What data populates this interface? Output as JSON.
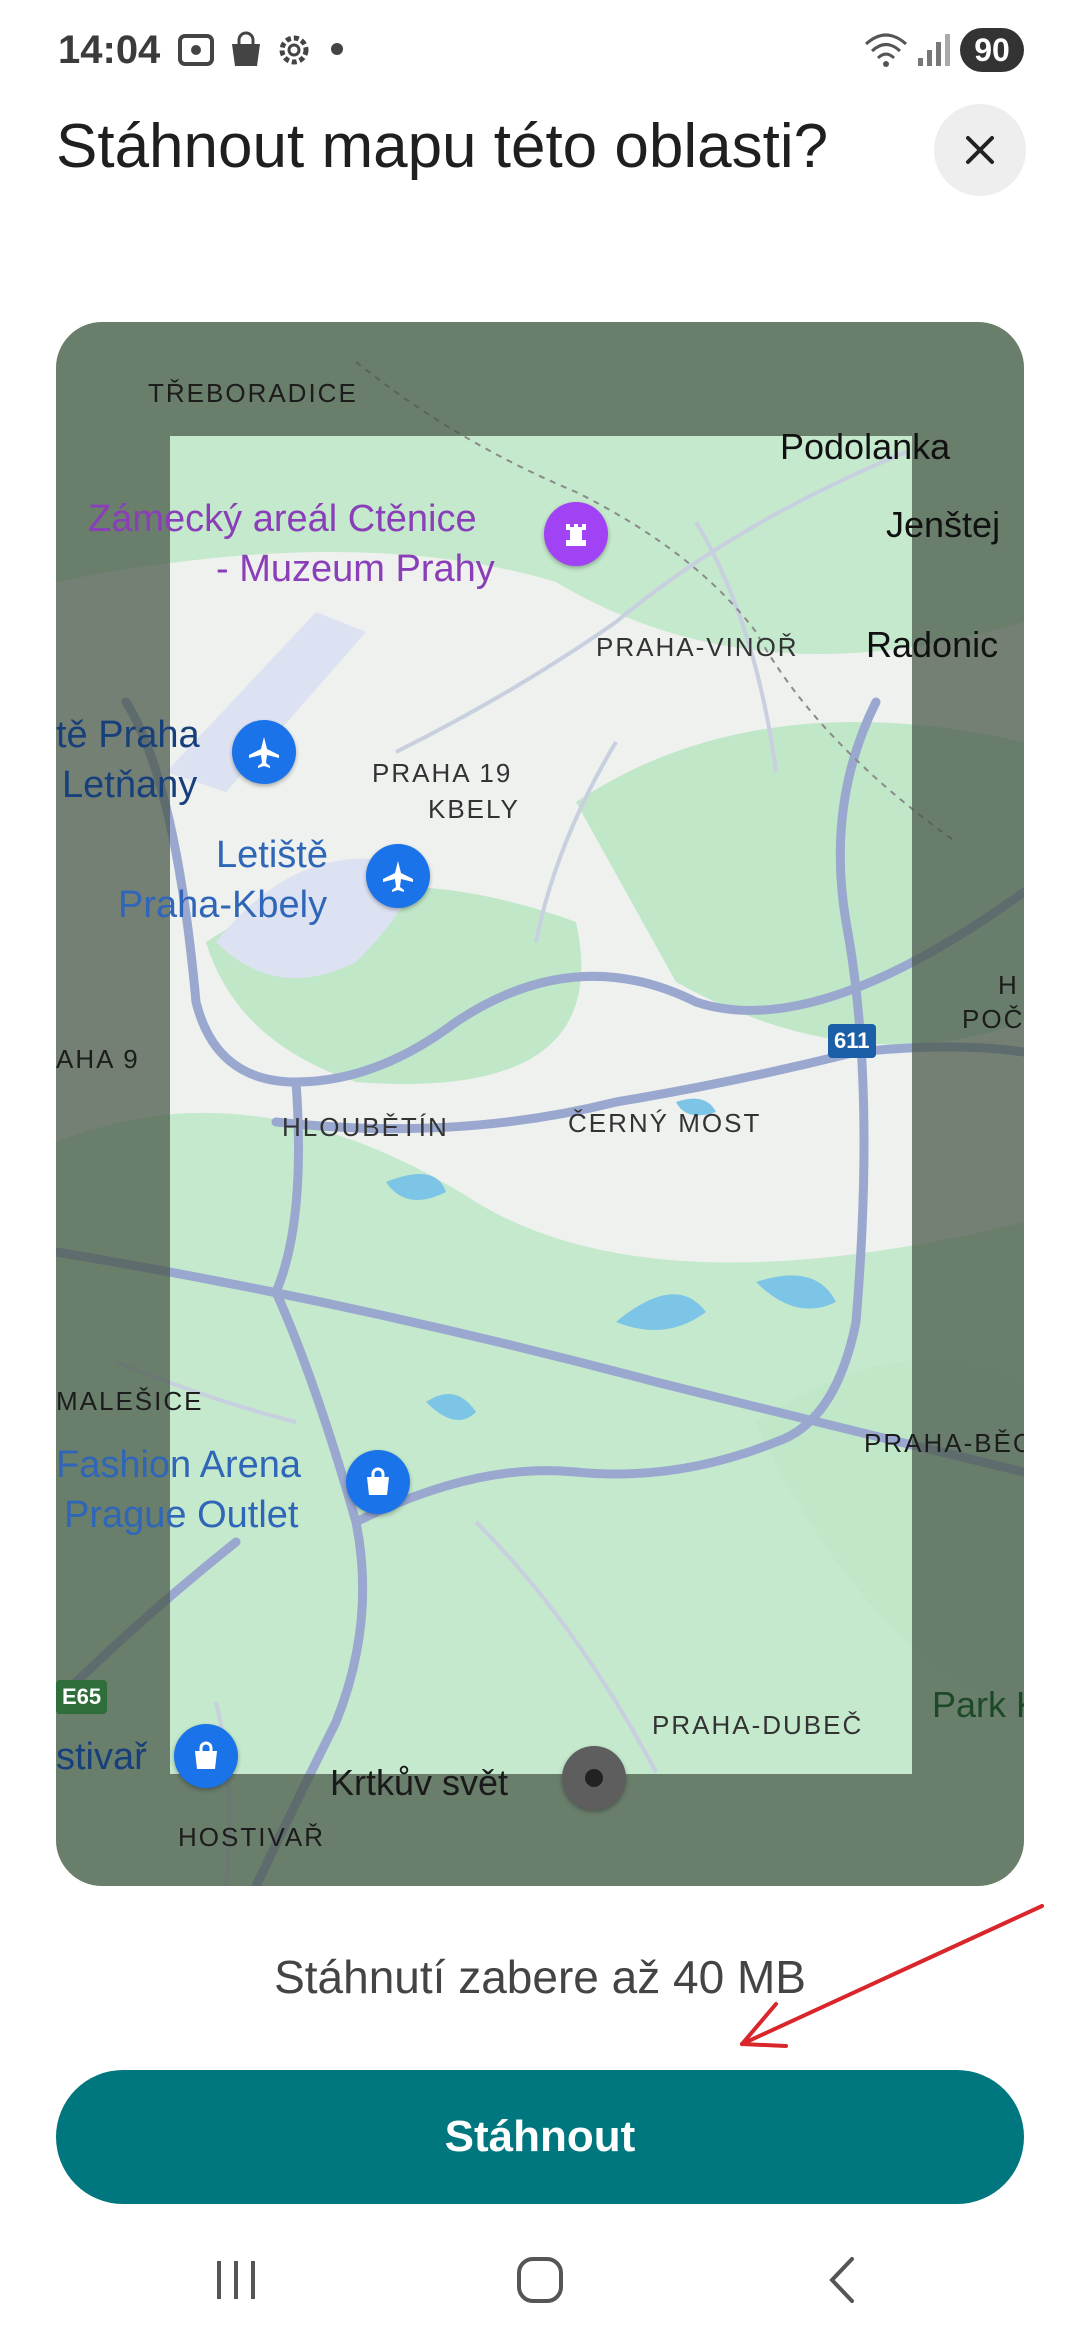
{
  "status_bar": {
    "time": "14:04",
    "battery": "90",
    "icons": [
      "screenshot-icon",
      "shopping-bag-icon",
      "settings-icon",
      "dot-icon",
      "wifi-icon",
      "signal-icon"
    ]
  },
  "dialog": {
    "title": "Stáhnout mapu této oblasti?",
    "close_icon": "close-icon"
  },
  "map": {
    "labels": {
      "treboradice": "TŘEBORADICE",
      "podolanka": "Podolanka",
      "jenstejn": "Jenštej",
      "ctenice_1": "Zámecký areál Ctěnice",
      "ctenice_2": "- Muzeum Prahy",
      "praha_vinor": "PRAHA-VINOŘ",
      "radonice": "Radonic",
      "letnany_1": "tě Praha",
      "letnany_2": "Letňany",
      "praha19": "PRAHA 19",
      "kbely": "KBELY",
      "kbely_airport_1": "Letiště",
      "kbely_airport_2": "Praha-Kbely",
      "poc_1": "H",
      "poc_2": "POČ",
      "praha9": "AHA 9",
      "hloubetin": "HLOUBĚTÍN",
      "cerny_most": "ČERNÝ MOST",
      "route_611": "611",
      "malesice": "MALEŠICE",
      "fashion_1": "Fashion Arena",
      "fashion_2": "Prague Outlet",
      "praha_bechovice": "PRAHA-BĚC",
      "e65": "E65",
      "hostivar_poi": "stivař",
      "praha_dubec": "PRAHA-DUBEČ",
      "park": "Park Ko",
      "krtkuv_svet": "Krtkův svět",
      "hostivar": "HOSTIVAŘ"
    },
    "colors": {
      "water": "#7dc5e6",
      "park": "#b9e6c4",
      "road": "#9aa8d0",
      "outside_dim": "#6f7d6e"
    }
  },
  "download": {
    "size_note": "Stáhnutí zabere až 40 MB",
    "button_label": "Stáhnout",
    "accent": "#00777f"
  },
  "nav_bar": {
    "recents": "recents-icon",
    "home": "home-icon",
    "back": "back-icon"
  },
  "annotation": {
    "arrow_color": "#d9262b"
  }
}
